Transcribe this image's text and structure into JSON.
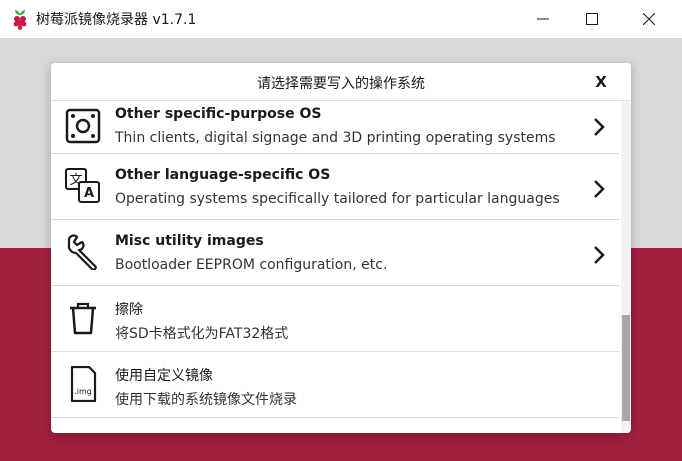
{
  "window": {
    "title": "树莓派镜像烧录器 v1.7.1",
    "icon": "raspberry-pi-logo"
  },
  "dialog": {
    "title": "请选择需要写入的操作系统",
    "close_label": "X"
  },
  "os_list": [
    {
      "title": "Other specific-purpose OS",
      "description": "Thin clients, digital signage and 3D printing operating systems",
      "icon": "specific-purpose-icon",
      "has_submenu": true
    },
    {
      "title": "Other language-specific OS",
      "description": "Operating systems specifically tailored for particular languages",
      "icon": "language-icon",
      "has_submenu": true
    },
    {
      "title": "Misc utility images",
      "description": "Bootloader EEPROM configuration, etc.",
      "icon": "wrench-icon",
      "has_submenu": true
    },
    {
      "title": "擦除",
      "description": "将SD卡格式化为FAT32格式",
      "icon": "trash-icon",
      "has_submenu": false
    },
    {
      "title": "使用自定义镜像",
      "description": "使用下载的系统镜像文件烧录",
      "icon": "img-file-icon",
      "has_submenu": false
    }
  ],
  "colors": {
    "accent": "#c51a4a",
    "background_bottom": "#a0203f",
    "background_top": "#d9d9d9"
  }
}
